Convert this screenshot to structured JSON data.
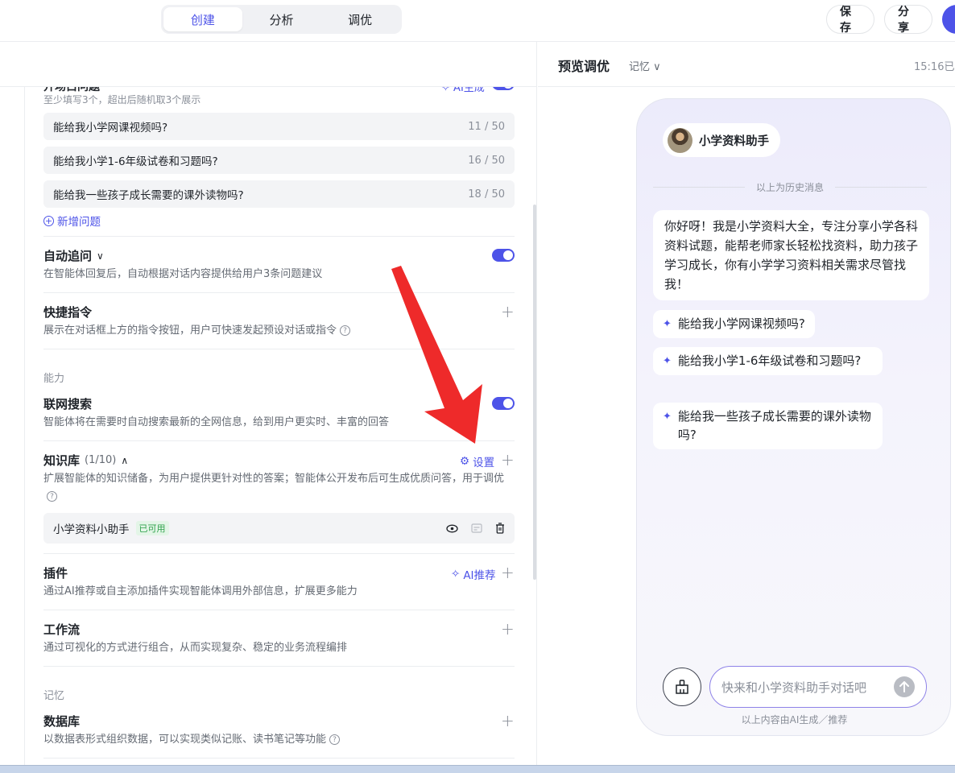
{
  "topbar": {
    "tabs": [
      {
        "label": "创建",
        "active": true
      },
      {
        "label": "分析",
        "active": false
      },
      {
        "label": "调优",
        "active": false
      }
    ],
    "save_label": "保存",
    "share_label": "分享"
  },
  "left": {
    "opening_questions": {
      "ai_label": "AI生成",
      "hint": "至少填写3个，超出后随机取3个展示",
      "items": [
        {
          "text": "能给我小学网课视频吗?",
          "count": "11 / 50"
        },
        {
          "text": "能给我小学1-6年级试卷和习题吗?",
          "count": "16 / 50"
        },
        {
          "text": "能给我一些孩子成长需要的课外读物吗?",
          "count": "18 / 50"
        }
      ],
      "add_label": "新增问题"
    },
    "auto_followup": {
      "title": "自动追问",
      "desc": "在智能体回复后，自动根据对话内容提供给用户3条问题建议"
    },
    "shortcuts": {
      "title": "快捷指令",
      "desc": "展示在对话框上方的指令按钮，用户可快速发起预设对话或指令"
    },
    "ability_label": "能力",
    "web_search": {
      "title": "联网搜索",
      "desc": "智能体将在需要时自动搜索最新的全网信息，给到用户更实时、丰富的回答"
    },
    "knowledge": {
      "title": "知识库",
      "count": "(1/10)",
      "settings_label": "设置",
      "desc": "扩展智能体的知识储备，为用户提供更针对性的答案；智能体公开发布后可生成优质问答，用于调优",
      "item_name": "小学资料小助手",
      "item_badge": "已可用"
    },
    "plugins": {
      "title": "插件",
      "ai_label": "AI推荐",
      "desc": "通过AI推荐或自主添加插件实现智能体调用外部信息，扩展更多能力"
    },
    "workflow": {
      "title": "工作流",
      "desc": "通过可视化的方式进行组合，从而实现复杂、稳定的业务流程编排"
    },
    "memory_label": "记忆",
    "database": {
      "title": "数据库",
      "desc": "以数据表形式组织数据，可以实现类似记账、读书笔记等功能"
    }
  },
  "right": {
    "title": "预览调优",
    "memory_label": "记忆",
    "time": "15:16已",
    "bot_name": "小学资料助手",
    "history_label": "以上为历史消息",
    "greeting": "你好呀！我是小学资料大全，专注分享小学各科资料试题，能帮老师家长轻松找资料，助力孩子学习成长，你有小学学习资料相关需求尽管找我！",
    "suggestions": [
      "能给我小学网课视频吗?",
      "能给我小学1-6年级试卷和习题吗?",
      "能给我一些孩子成长需要的课外读物吗?"
    ],
    "input_placeholder": "快来和小学资料助手对话吧",
    "footer_note": "以上内容由AI生成／推荐"
  },
  "colors": {
    "accent": "#4d53e8",
    "annotation_arrow": "#ee2a2a"
  }
}
